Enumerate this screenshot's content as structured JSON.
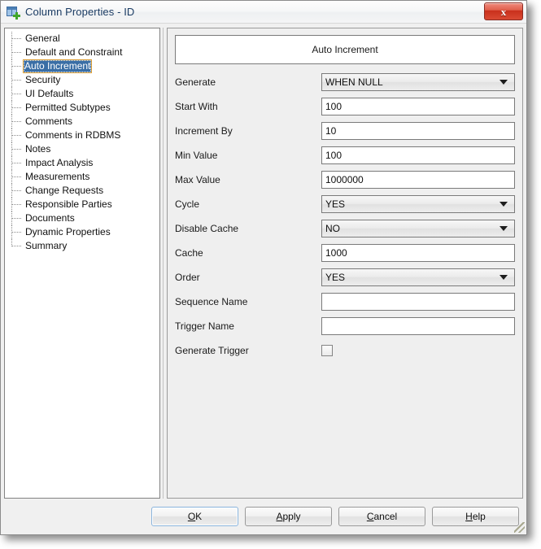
{
  "window": {
    "title": "Column Properties - ID",
    "icon": "table-column-add-icon",
    "close_label": "x"
  },
  "sidebar": {
    "items": [
      {
        "label": "General",
        "selected": false
      },
      {
        "label": "Default and Constraint",
        "selected": false
      },
      {
        "label": "Auto Increment",
        "selected": true
      },
      {
        "label": "Security",
        "selected": false
      },
      {
        "label": "UI Defaults",
        "selected": false
      },
      {
        "label": "Permitted Subtypes",
        "selected": false
      },
      {
        "label": "Comments",
        "selected": false
      },
      {
        "label": "Comments in RDBMS",
        "selected": false
      },
      {
        "label": "Notes",
        "selected": false
      },
      {
        "label": "Impact Analysis",
        "selected": false
      },
      {
        "label": "Measurements",
        "selected": false
      },
      {
        "label": "Change Requests",
        "selected": false
      },
      {
        "label": "Responsible Parties",
        "selected": false
      },
      {
        "label": "Documents",
        "selected": false
      },
      {
        "label": "Dynamic Properties",
        "selected": false
      },
      {
        "label": "Summary",
        "selected": false
      }
    ]
  },
  "main": {
    "panel_title": "Auto Increment",
    "fields": [
      {
        "label": "Generate",
        "type": "combobox",
        "value": "WHEN NULL"
      },
      {
        "label": "Start With",
        "type": "textbox",
        "value": "100"
      },
      {
        "label": "Increment By",
        "type": "textbox",
        "value": "10"
      },
      {
        "label": "Min Value",
        "type": "textbox",
        "value": "100"
      },
      {
        "label": "Max Value",
        "type": "textbox",
        "value": "1000000"
      },
      {
        "label": "Cycle",
        "type": "combobox",
        "value": "YES"
      },
      {
        "label": "Disable Cache",
        "type": "combobox",
        "value": "NO"
      },
      {
        "label": "Cache",
        "type": "textbox",
        "value": "1000"
      },
      {
        "label": "Order",
        "type": "combobox",
        "value": "YES"
      },
      {
        "label": "Sequence Name",
        "type": "textbox",
        "value": ""
      },
      {
        "label": "Trigger Name",
        "type": "textbox",
        "value": ""
      },
      {
        "label": "Generate Trigger",
        "type": "checkbox",
        "checked": false
      }
    ]
  },
  "buttons": [
    {
      "label": "OK",
      "mnemonic": "O",
      "default": true
    },
    {
      "label": "Apply",
      "mnemonic": "A",
      "default": false
    },
    {
      "label": "Cancel",
      "mnemonic": "C",
      "default": false
    },
    {
      "label": "Help",
      "mnemonic": "H",
      "default": false
    }
  ],
  "colors": {
    "selection_blue": "#3a6ea5",
    "selection_outline": "#d79a32",
    "dialog_face": "#f0f0f0",
    "close_red": "#c9301c",
    "title_text": "#1a3b63"
  }
}
